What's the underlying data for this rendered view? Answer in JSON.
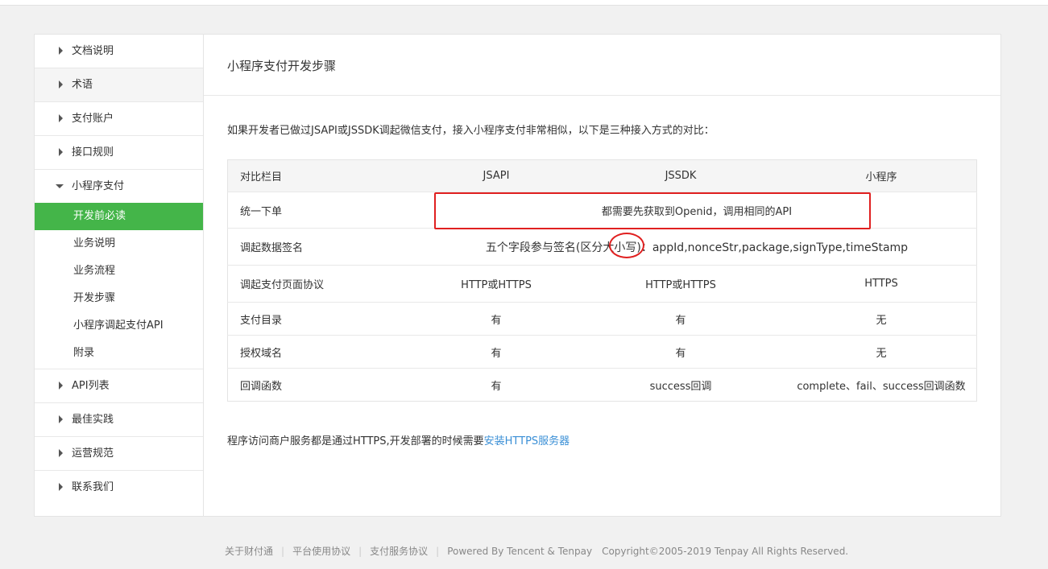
{
  "sidebar": {
    "items_top": [
      {
        "label": "文档说明"
      },
      {
        "label": "术语"
      },
      {
        "label": "支付账户"
      },
      {
        "label": "接口规则"
      }
    ],
    "open_item": {
      "label": "小程序支付"
    },
    "sub_items": [
      {
        "label": "开发前必读"
      },
      {
        "label": "业务说明"
      },
      {
        "label": "业务流程"
      },
      {
        "label": "开发步骤"
      },
      {
        "label": "小程序调起支付API"
      },
      {
        "label": "附录"
      }
    ],
    "items_bottom": [
      {
        "label": "API列表"
      },
      {
        "label": "最佳实践"
      },
      {
        "label": "运营规范"
      },
      {
        "label": "联系我们"
      }
    ]
  },
  "main": {
    "title": "小程序支付开发步骤",
    "intro": "如果开发者已做过JSAPI或JSSDK调起微信支付，接入小程序支付非常相似，以下是三种接入方式的对比：",
    "table": {
      "headers": [
        "对比栏目",
        "JSAPI",
        "JSSDK",
        "小程序"
      ],
      "row_unified": {
        "label": "统一下单",
        "value": "都需要先获取到Openid，调用相同的API"
      },
      "row_sign": {
        "label": "调起数据签名",
        "value": "五个字段参与签名(区分大小写)：appId,nonceStr,package,signType,timeStamp"
      },
      "rows": [
        [
          "调起支付页面协议",
          "HTTP或HTTPS",
          "HTTP或HTTPS",
          "HTTPS"
        ],
        [
          "支付目录",
          "有",
          "有",
          "无"
        ],
        [
          "授权域名",
          "有",
          "有",
          "无"
        ],
        [
          "回调函数",
          "有",
          "success回调",
          "complete、fail、success回调函数"
        ]
      ]
    },
    "note_prefix": "程序访问商户服务都是通过HTTPS,开发部署的时候需要",
    "note_link": "安装HTTPS服务器"
  },
  "footer": {
    "links": [
      "关于财付通",
      "平台使用协议",
      "支付服务协议"
    ],
    "powered": "Powered By Tencent & Tenpay",
    "copyright": "Copyright©2005-2019 Tenpay All Rights Reserved."
  },
  "colors": {
    "accent_green": "#44b549",
    "link_blue": "#3a8fd6",
    "highlight_red": "#e02020"
  }
}
